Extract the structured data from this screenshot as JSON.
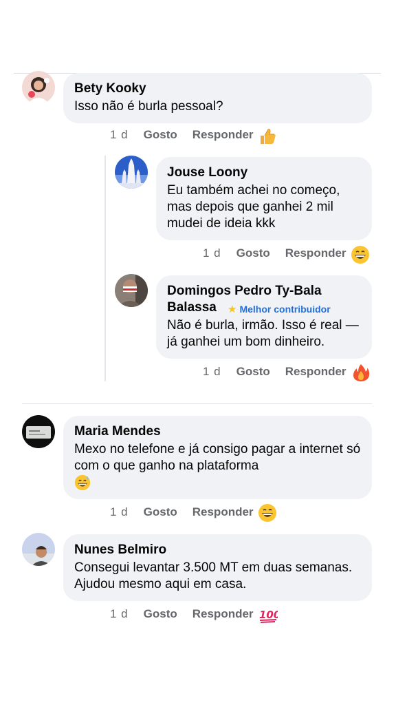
{
  "comments": [
    {
      "author": "Bety Kooky",
      "text": "Isso não é burla pessoal?",
      "time": "1 d",
      "like": "Gosto",
      "reply": "Responder",
      "reaction": "thumbs-up-icon"
    },
    {
      "author": "Jouse Loony",
      "text": "Eu também achei no começo, mas depois que ganhei 2 mil mudei de ideia kkk",
      "time": "1 d",
      "like": "Gosto",
      "reply": "Responder",
      "reaction": "grinning-face-icon"
    },
    {
      "author": "Domingos Pedro Ty-Bala Balassa",
      "badge": "Melhor contribuidor",
      "text": "Não é burla, irmão. Isso é real — já ganhei um bom dinheiro.",
      "time": "1 d",
      "like": "Gosto",
      "reply": "Responder",
      "reaction": "fire-icon"
    },
    {
      "author": "Maria Mendes",
      "text": "Mexo no telefone e já consigo pagar a internet só com o que ganho na plataforma",
      "text_emoji": "sweat-smile-icon",
      "time": "1 d",
      "like": "Gosto",
      "reply": "Responder",
      "reaction": "grinning-face-icon"
    },
    {
      "author": "Nunes Belmiro",
      "text": "Consegui levantar 3.500 MT em duas semanas. Ajudou mesmo aqui em casa.",
      "time": "1 d",
      "like": "Gosto",
      "reply": "Responder",
      "reaction": "hundred-points-icon"
    }
  ],
  "colors": {
    "bubble": "#f0f2f5",
    "meta_text": "#65676b",
    "badge": "#216fdb",
    "divider": "#dcdfe3"
  }
}
